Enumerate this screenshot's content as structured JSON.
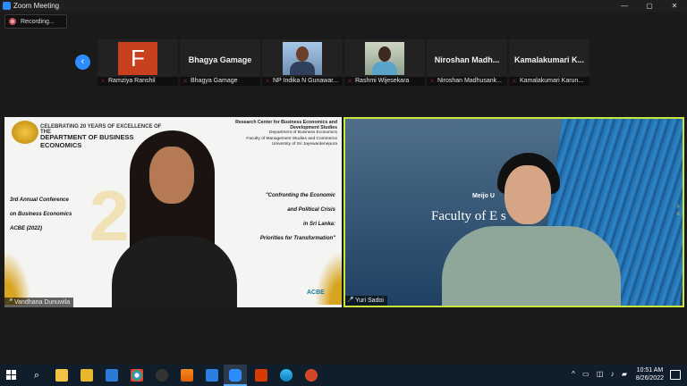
{
  "window": {
    "title": "Zoom Meeting"
  },
  "recording": {
    "label": "Recording..."
  },
  "thumbnails": [
    {
      "display": "F",
      "label": "Ramziya Ranshil",
      "type": "avatar",
      "color": "#c9401f"
    },
    {
      "display": "Bhagya Gamage",
      "label": "Bhagya Gamage",
      "type": "name"
    },
    {
      "display": "",
      "label": "NP Indika N Gunawar...",
      "type": "photo"
    },
    {
      "display": "",
      "label": "Rashmi Wijesekara",
      "type": "photo"
    },
    {
      "display": "Niroshan  Madh...",
      "label": "Niroshan Madhusank...",
      "type": "name"
    },
    {
      "display": "Kamalakumari  K...",
      "label": "Kamalakumari Karun...",
      "type": "name"
    }
  ],
  "main_videos": [
    {
      "label": "Vandhana Dunuwila",
      "banner_top": "CELEBRATING 20 YEARS OF EXCELLENCE OF THE",
      "banner_main": "DEPARTMENT OF BUSINESS ECONOMICS",
      "research_center": "Research Center for Business Economics and Development Studies",
      "dept_lines": [
        "Department of Business Economics",
        "Faculty of Management Studies and Commerce",
        "University of Sri Jayewardenepura"
      ],
      "conference_lines": [
        "3rd Annual Conference",
        "on Business Economics",
        "ACBE (2022)"
      ],
      "theme_lines": [
        "\"Confronting the Economic",
        "and Political Crisis",
        "in Sri Lanka:",
        "Priorities for Transformation\""
      ],
      "logo_text": "ACBE"
    },
    {
      "label": "Yuri Sadoi",
      "sign_small": "Meijo U",
      "sign_large": "Faculty of E        s",
      "side_text": "F ... E"
    }
  ],
  "taskbar": {
    "time": "10:51 AM",
    "date": "8/26/2022",
    "accent": "#5ab0ff"
  }
}
